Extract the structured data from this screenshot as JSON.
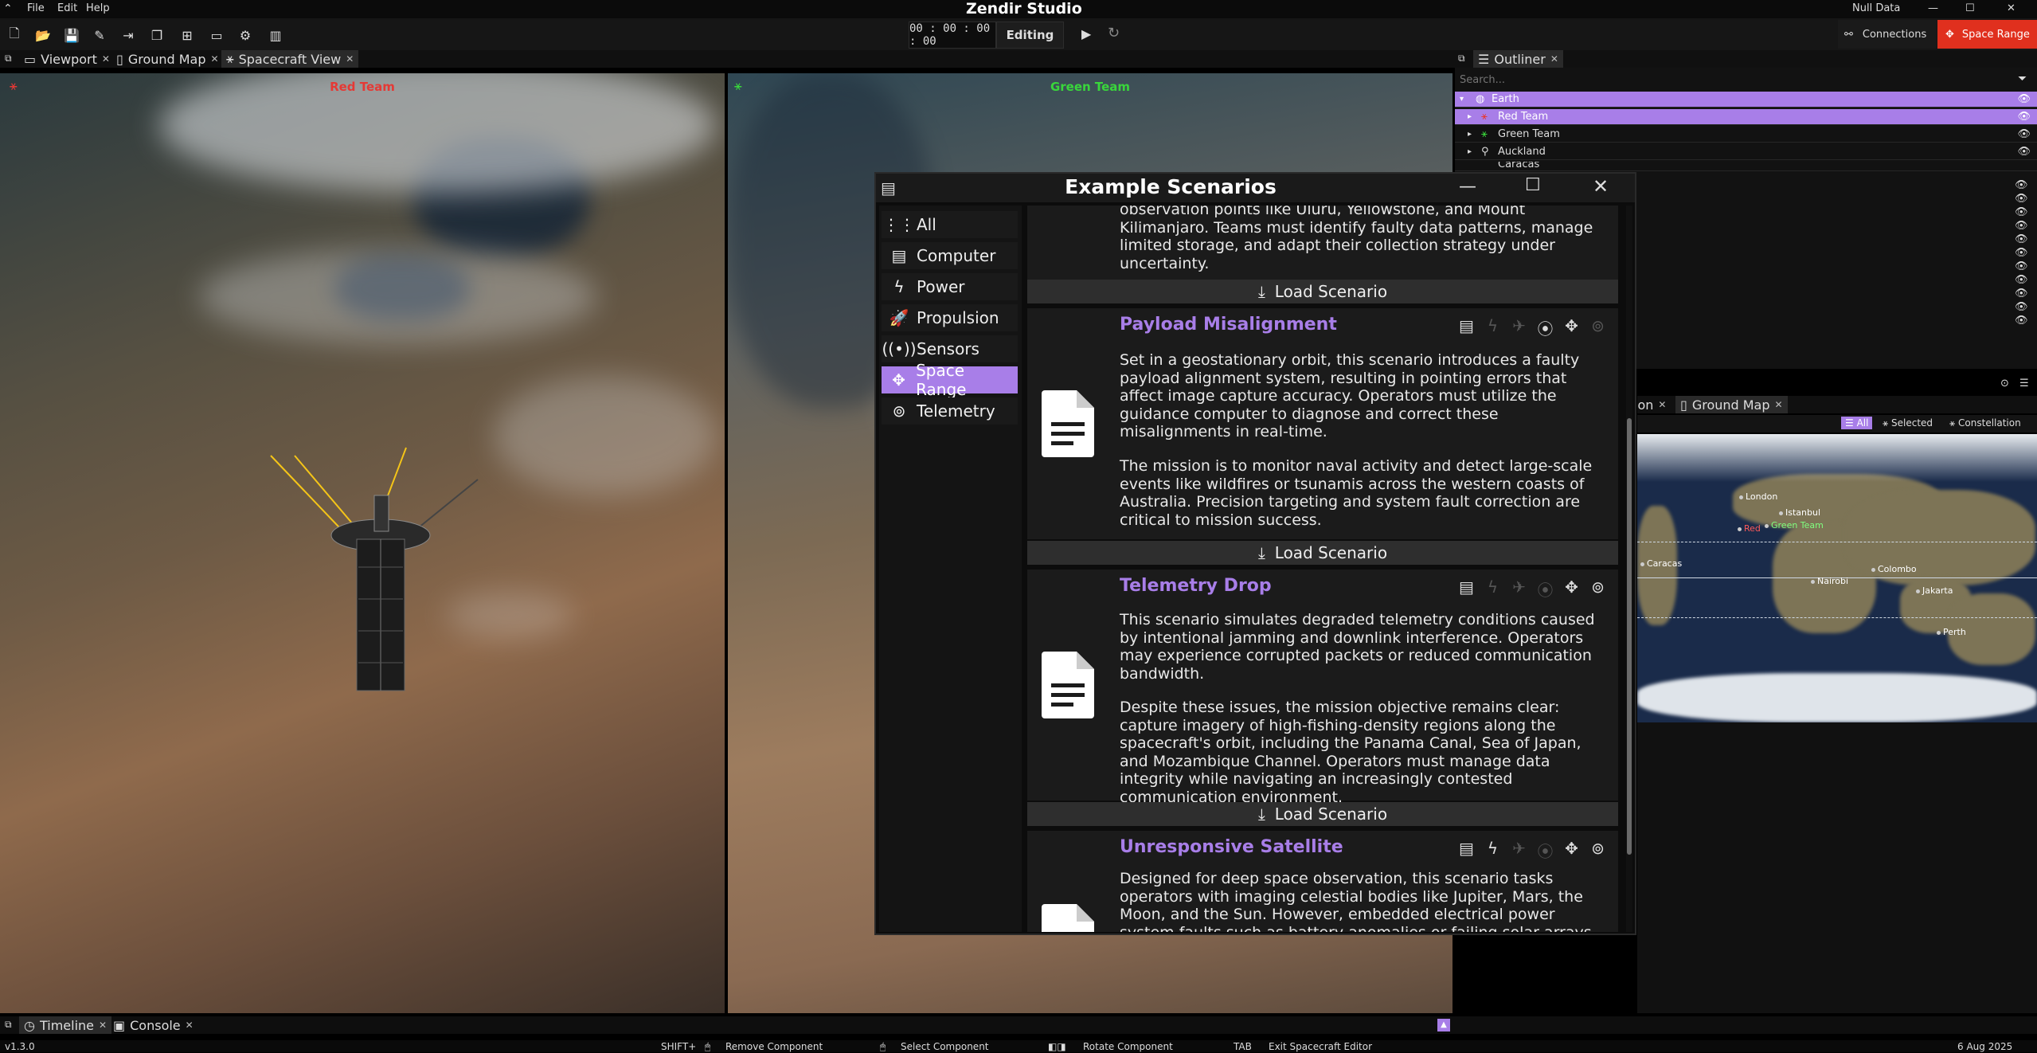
{
  "app": {
    "title": "Zendir Studio",
    "user": "Null Data"
  },
  "menu": [
    "File",
    "Edit",
    "Help"
  ],
  "top_right": {
    "connections_label": "Connections",
    "space_range_label": "Space Range",
    "accent": "#e0301e"
  },
  "timer": {
    "time": "00 : 00 : 00 : 00",
    "mode": "Editing"
  },
  "tabs": {
    "viewport": "Viewport",
    "ground_map": "Ground Map",
    "spacecraft_view": "Spacecraft View",
    "outliner": "Outliner",
    "ground_map_2": "Ground Map",
    "partial_tab": "ion"
  },
  "viewports": {
    "left_team": "Red Team",
    "right_team": "Green Team",
    "left_color": "#e53935",
    "right_color": "#39d63b"
  },
  "outliner": {
    "search_placeholder": "Search...",
    "items": [
      "Earth",
      "Red Team",
      "Green Team",
      "Auckland",
      "Caracas"
    ]
  },
  "map_filters": {
    "all": "All",
    "selected": "Selected",
    "constellation": "Constellation"
  },
  "map_cities": [
    "London",
    "Istanbul",
    "Red",
    "Green Team",
    "Caracas",
    "Colombo",
    "Nairobi",
    "Jakarta",
    "Perth"
  ],
  "dialog": {
    "title": "Example Scenarios",
    "categories": [
      {
        "label": "All",
        "icon": "grid-icon"
      },
      {
        "label": "Computer",
        "icon": "chip-icon"
      },
      {
        "label": "Power",
        "icon": "bolt-icon"
      },
      {
        "label": "Propulsion",
        "icon": "rocket-icon"
      },
      {
        "label": "Sensors",
        "icon": "signal-icon"
      },
      {
        "label": "Space Range",
        "icon": "move-icon"
      },
      {
        "label": "Telemetry",
        "icon": "antenna-icon"
      }
    ],
    "active_category": "Space Range",
    "load_label": "Load Scenario",
    "partial_top_text": [
      "observation points like Uluru, Yellowstone, and Mount",
      "Kilimanjaro. Teams must identify faulty data patterns, manage",
      "limited storage, and adapt their collection strategy under",
      "uncertainty."
    ],
    "scenarios": [
      {
        "title": "Payload Misalignment",
        "desc1": "Set in a geostationary orbit, this scenario introduces a faulty payload alignment system, resulting in pointing errors that affect image capture accuracy. Operators must utilize the guidance computer to diagnose and correct these misalignments in real-time.",
        "desc2": "The mission is to monitor naval activity and detect large-scale events like wildfires or tsunamis across the western coasts of Australia. Precision targeting and system fault correction are critical to mission success."
      },
      {
        "title": "Telemetry Drop",
        "desc1": "This scenario simulates degraded telemetry conditions caused by intentional jamming and downlink interference. Operators may experience corrupted packets or reduced communication bandwidth.",
        "desc2": "Despite these issues, the mission objective remains clear: capture imagery of high-fishing-density regions along the spacecraft's orbit, including the Panama Canal, Sea of Japan, and Mozambique Channel. Operators must manage data integrity while navigating an increasingly contested communication environment."
      },
      {
        "title": "Unresponsive Satellite",
        "desc1": "Designed for deep space observation, this scenario tasks operators with imaging celestial bodies like Jupiter, Mars, the Moon, and the Sun. However, embedded electrical power system faults such as battery anomalies or failing solar arrays may"
      }
    ]
  },
  "bottom": {
    "timeline": "Timeline",
    "console": "Console",
    "version": "v1.3.0",
    "hints": [
      "SHIFT+",
      "Remove Component",
      "Select Component",
      "Rotate Component",
      "TAB",
      "Exit Spacecraft Editor"
    ],
    "date": "6 Aug 2025"
  }
}
